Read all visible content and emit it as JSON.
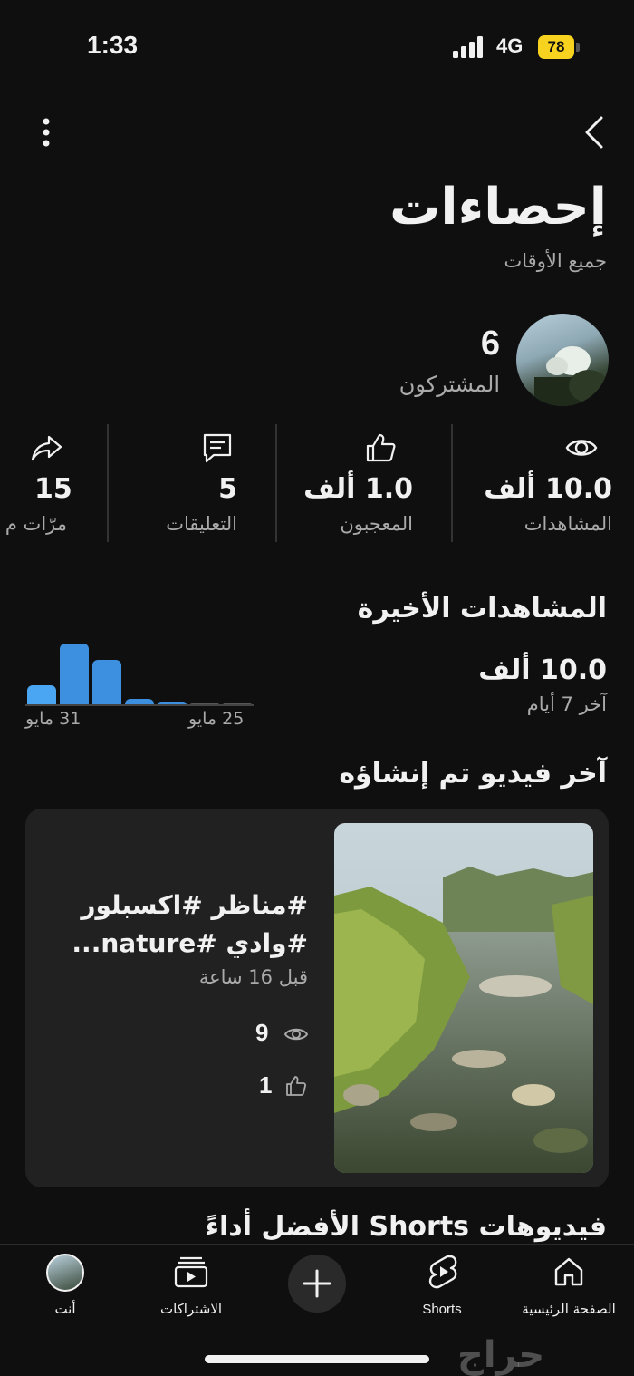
{
  "status_bar": {
    "time": "1:33",
    "network": "4G",
    "battery": "78"
  },
  "header": {
    "title": "إحصاءات",
    "subtitle": "جميع الأوقات"
  },
  "channel": {
    "subscribers_count": "6",
    "subscribers_label": "المشتركون"
  },
  "metrics": [
    {
      "key": "views",
      "icon": "eye-icon",
      "value": "10.0 ألف",
      "label": "المشاهدات"
    },
    {
      "key": "likes",
      "icon": "thumbs-up-icon",
      "value": "1.0 ألف",
      "label": "المعجبون"
    },
    {
      "key": "comments",
      "icon": "comment-icon",
      "value": "5",
      "label": "التعليقات"
    },
    {
      "key": "shares",
      "icon": "share-icon",
      "value": "15",
      "label": "مرّات م"
    }
  ],
  "recent_views": {
    "title": "المشاهدات الأخيرة",
    "value": "10.0 ألف",
    "period": "آخر 7 أيام",
    "start_label": "25 مايو",
    "end_label": "31 مايو"
  },
  "chart_data": {
    "type": "bar",
    "values": [
      0.02,
      0.02,
      0.05,
      0.1,
      0.7,
      0.95,
      0.3
    ],
    "x_start_label": "25 مايو",
    "x_end_label": "31 مايو",
    "colors": {
      "bar": "#3d8fe0",
      "latest_bar": "#4aa6f2",
      "empty": "#555555"
    }
  },
  "latest_video": {
    "section_title": "آخر فيديو تم إنشاؤه",
    "title_line1": "#مناظر #اكسبلور",
    "title_line2": "#وادي #nature...",
    "age": "قبل 16 ساعة",
    "views": "9",
    "likes": "1"
  },
  "top_shorts": {
    "title": "فيديوهات Shorts الأفضل أداءً"
  },
  "bottom_nav": {
    "home": "الصفحة الرئيسية",
    "shorts": "Shorts",
    "subscriptions": "الاشتراكات",
    "you": "أنت"
  },
  "watermark": "حراج",
  "colors": {
    "background": "#0f0f0f",
    "card": "#212121",
    "text_secondary": "#aaaaaa",
    "battery": "#f7d21e"
  }
}
